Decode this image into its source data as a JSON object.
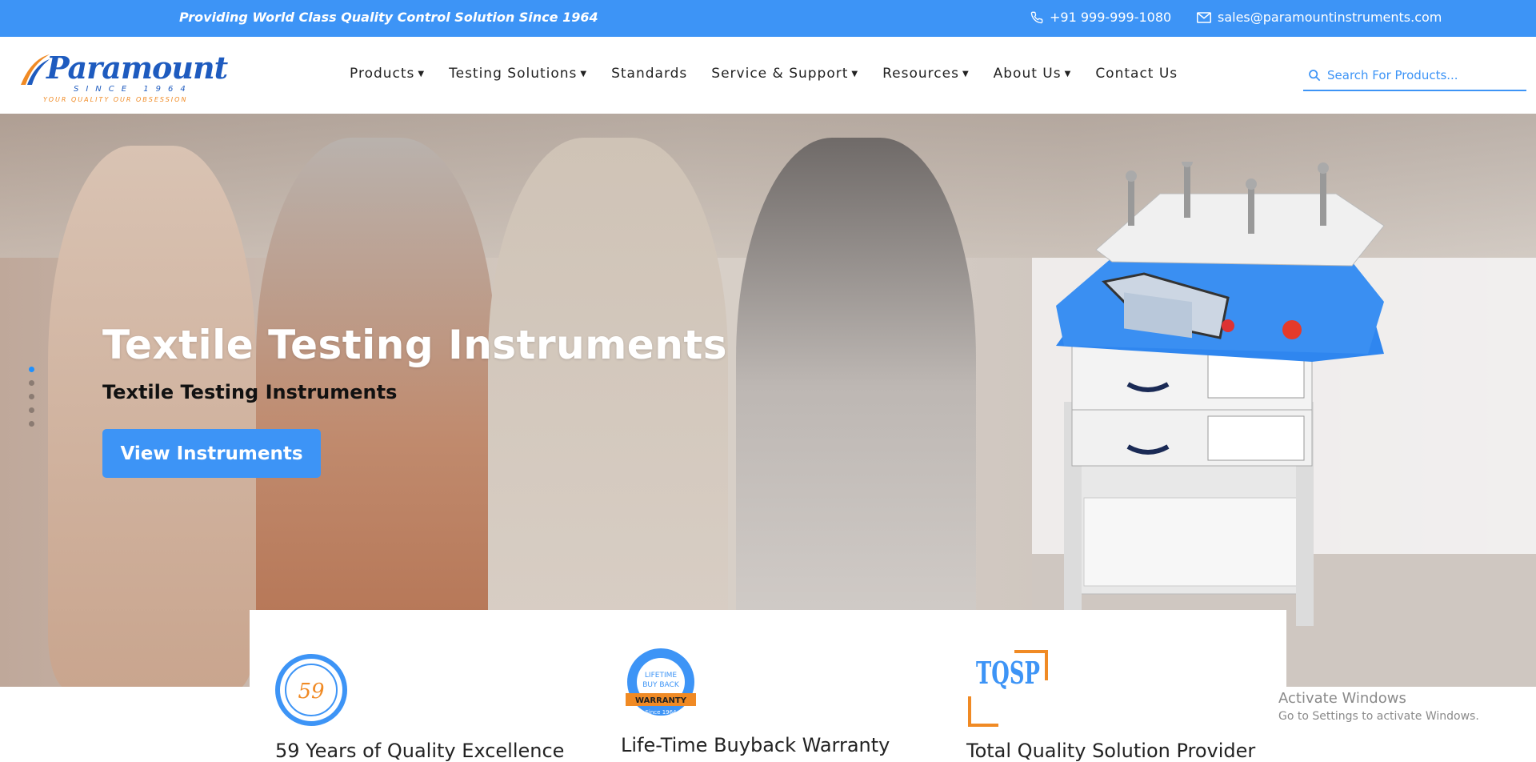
{
  "topbar": {
    "tagline": "Providing World Class Quality Control Solution Since 1964",
    "phone": "+91 999-999-1080",
    "email": "sales@paramountinstruments.com"
  },
  "logo": {
    "brand": "Paramount",
    "since": "SINCE 1964",
    "motto": "YOUR QUALITY OUR OBSESSION"
  },
  "nav": {
    "items": [
      {
        "label": "Products",
        "dropdown": true
      },
      {
        "label": "Testing Solutions",
        "dropdown": true
      },
      {
        "label": "Standards",
        "dropdown": false
      },
      {
        "label": "Service & Support",
        "dropdown": true
      },
      {
        "label": "Resources",
        "dropdown": true
      },
      {
        "label": "About Us",
        "dropdown": true
      },
      {
        "label": "Contact Us",
        "dropdown": false
      }
    ]
  },
  "search": {
    "placeholder": "Search For Products..."
  },
  "hero": {
    "title": "Textile Testing Instruments",
    "subtitle": "Textile Testing Instruments",
    "button": "View Instruments",
    "slide_count": 5,
    "active_slide": 1
  },
  "features": [
    {
      "label": "59 Years of Quality Excellence",
      "badge": "59"
    },
    {
      "label": "Life-Time Buyback Warranty",
      "badge_top": "LIFETIME",
      "badge_mid": "BUY BACK",
      "badge_ribbon": "WARRANTY",
      "badge_since": "Since 1964"
    },
    {
      "label": "Total Quality Solution Provider",
      "badge": "TQSP"
    }
  ],
  "watermark": {
    "line1": "Activate Windows",
    "line2": "Go to Settings to activate Windows."
  },
  "colors": {
    "accent": "#3d94f6",
    "brand": "#1e5bbf",
    "orange": "#f08a24"
  }
}
